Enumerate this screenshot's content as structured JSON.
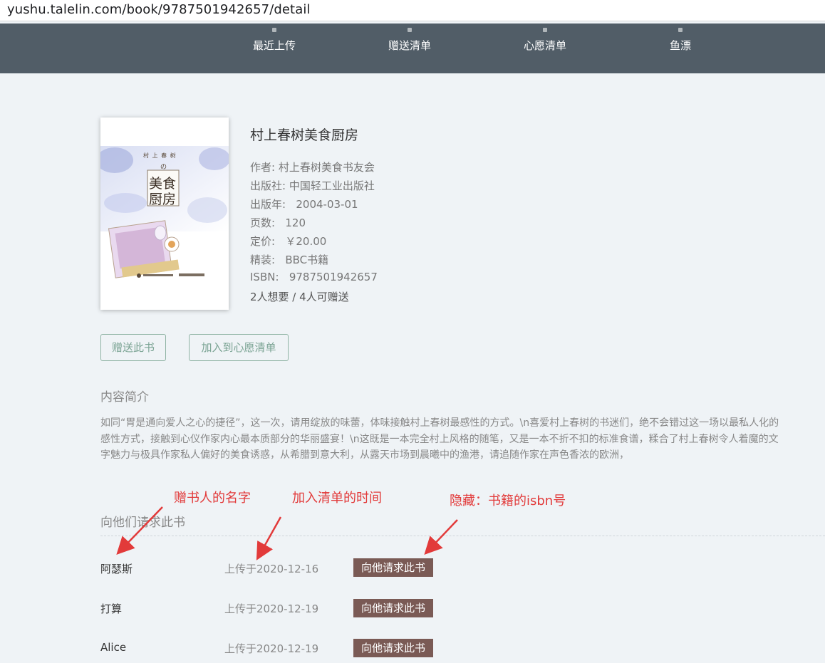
{
  "browser": {
    "url": "yushu.talelin.com/book/9787501942657/detail"
  },
  "nav": {
    "items": [
      {
        "label": "最近上传"
      },
      {
        "label": "赠送清单"
      },
      {
        "label": "心愿清单"
      },
      {
        "label": "鱼漂"
      }
    ]
  },
  "book": {
    "title": "村上春树美食厨房",
    "cover": {
      "series": "村 上 春 树",
      "particle": "の",
      "title_line1": "美食",
      "title_line2": "厨房"
    },
    "author": "作者: 村上春树美食书友会",
    "publisher": "出版社: 中国轻工业出版社",
    "pubdate": "出版年:   2004-03-01",
    "pages": "页数:   120",
    "price": "定价:   ￥20.00",
    "binding": "精装:   BBC书籍",
    "isbn": "ISBN:   9787501942657",
    "stats": "2人想要 / 4人可赠送"
  },
  "actions": {
    "gift_label": "赠送此书",
    "wish_label": "加入到心愿清单"
  },
  "summary": {
    "heading": "内容简介",
    "text": "如同“胃是通向爱人之心的捷径”，这一次，请用绽放的味蕾，体味接触村上春树最感性的方式。\\n喜爱村上春树的书迷们，绝不会错过这一场以最私人化的感性方式，接触到心仪作家内心最本质部分的华丽盛宴！\\n这既是一本完全村上风格的随笔，又是一本不折不扣的标准食谱，糅合了村上春树令人着魔的文字魅力与极具作家私人偏好的美食诱惑，从希腊到意大利，从露天市场到晨曦中的渔港，请追随作家在声色香浓的欧洲，"
  },
  "givers": {
    "heading": "向他们请求此书",
    "request_label": "向他请求此书",
    "rows": [
      {
        "name": "阿瑟斯",
        "time": "上传于2020-12-16"
      },
      {
        "name": "打算",
        "time": "上传于2020-12-19"
      },
      {
        "name": "Alice",
        "time": "上传于2020-12-19"
      }
    ]
  },
  "annotations": {
    "name_note": "赠书人的名字",
    "time_note": "加入清单的时间",
    "isbn_note": "隐藏：书籍的isbn号"
  },
  "colors": {
    "nav_bg": "#515d67",
    "page_bg": "#eff3f6",
    "accent_outline": "#7aa393",
    "request_button": "#7a5a55",
    "annotation": "#e23a3a"
  }
}
